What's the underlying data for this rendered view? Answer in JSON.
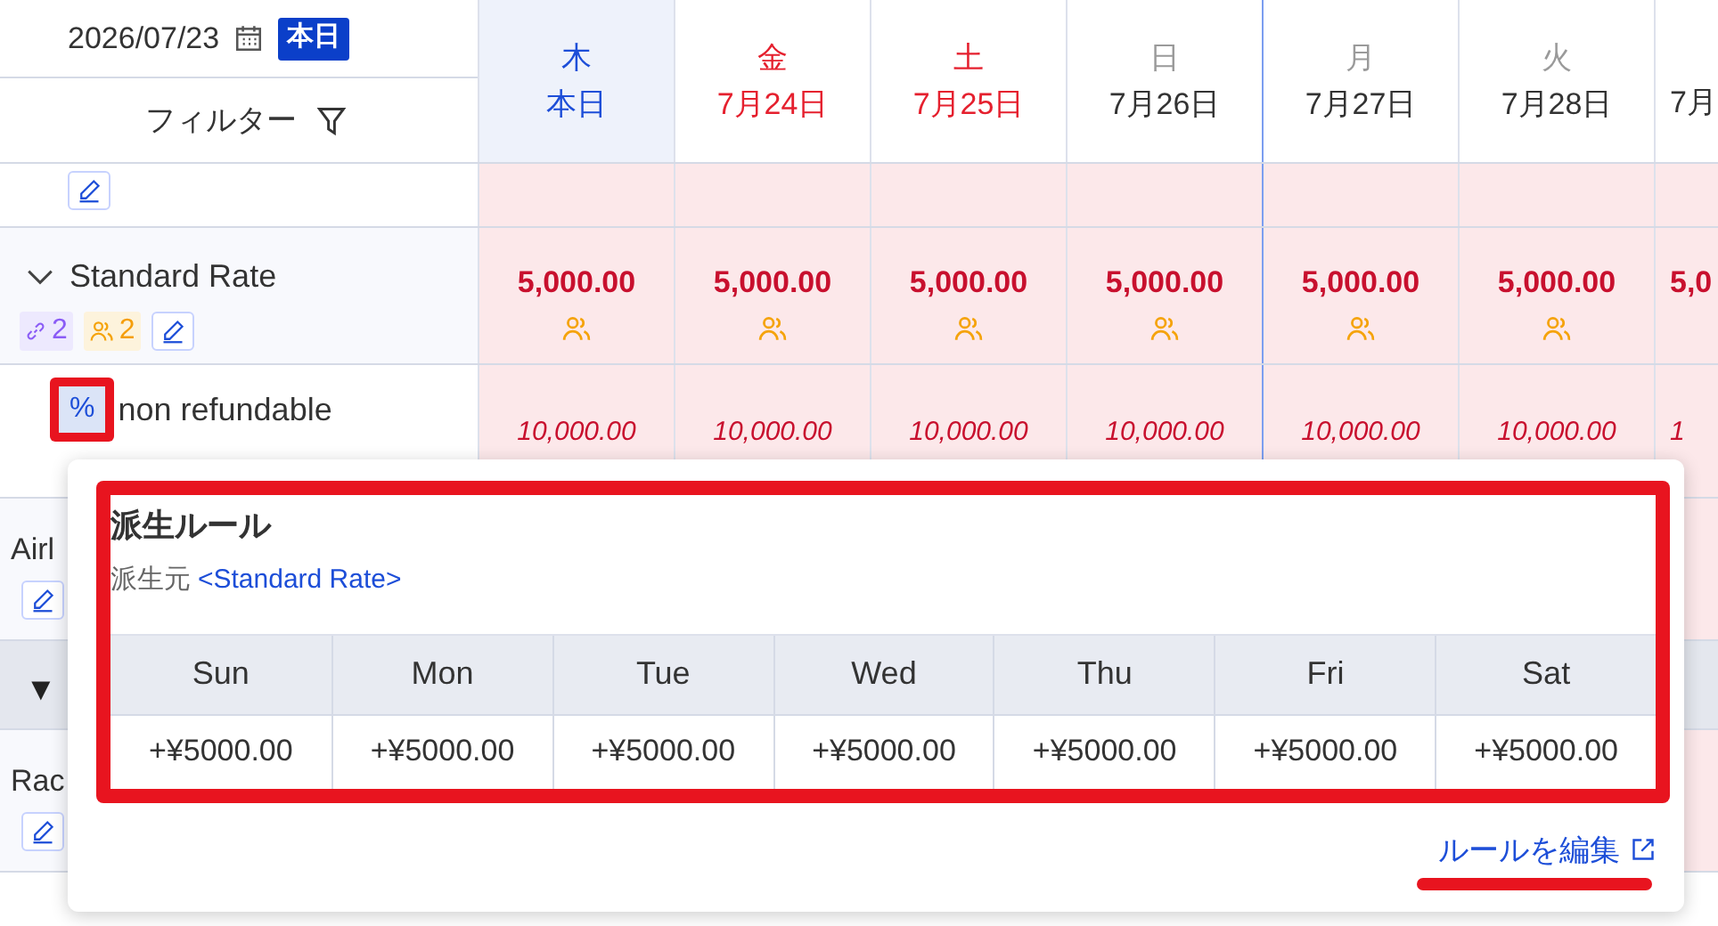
{
  "toolbar": {
    "date": "2026/07/23",
    "today_button": "本日",
    "filter": "フィルター"
  },
  "days": [
    {
      "weekday": "木",
      "date": "本日",
      "kind": "today",
      "week_start": false
    },
    {
      "weekday": "金",
      "date": "7月24日",
      "kind": "holiday",
      "week_start": false
    },
    {
      "weekday": "土",
      "date": "7月25日",
      "kind": "holiday",
      "week_start": false
    },
    {
      "weekday": "日",
      "date": "7月26日",
      "kind": "normal",
      "week_start": false
    },
    {
      "weekday": "月",
      "date": "7月27日",
      "kind": "normal",
      "week_start": true
    },
    {
      "weekday": "火",
      "date": "7月28日",
      "kind": "normal",
      "week_start": false
    },
    {
      "date": "7月",
      "kind": "normal",
      "week_start": false
    }
  ],
  "rows": [
    {
      "kind": "partial",
      "editable": true
    },
    {
      "kind": "rate",
      "name": "Standard Rate",
      "expanded": true,
      "links": "2",
      "guests": "2",
      "editable": true,
      "values": [
        "5,000.00",
        "5,000.00",
        "5,000.00",
        "5,000.00",
        "5,000.00",
        "5,000.00",
        "5,0"
      ]
    },
    {
      "kind": "derived",
      "badge": "%",
      "name": "non refundable",
      "highlighted": true,
      "values": [
        "10,000.00",
        "10,000.00",
        "10,000.00",
        "10,000.00",
        "10,000.00",
        "10,000.00",
        "1"
      ]
    },
    {
      "kind": "plain",
      "name": "Airl",
      "editable": true
    },
    {
      "kind": "group",
      "toggle": "▼"
    },
    {
      "kind": "plain",
      "name": "Rac",
      "editable": true
    }
  ],
  "popover": {
    "title": "派生ルール",
    "source_label": "派生元",
    "source_link": "<Standard Rate>",
    "highlighted": true,
    "columns": [
      "Sun",
      "Mon",
      "Tue",
      "Wed",
      "Thu",
      "Fri",
      "Sat"
    ],
    "values": [
      "+¥5000.00",
      "+¥5000.00",
      "+¥5000.00",
      "+¥5000.00",
      "+¥5000.00",
      "+¥5000.00",
      "+¥5000.00"
    ],
    "edit_link": "ルールを編集",
    "edit_link_underlined": true
  }
}
